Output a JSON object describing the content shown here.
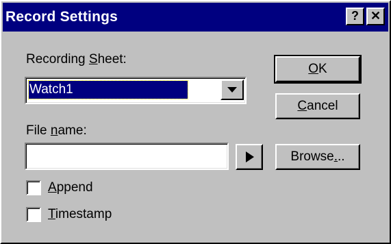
{
  "window": {
    "title": "Record Settings",
    "help_glyph": "?",
    "close_glyph": "✕"
  },
  "recording_sheet": {
    "label_pre": "Recording ",
    "label_mnemonic": "S",
    "label_post": "heet:",
    "selected": "Watch1"
  },
  "file_name": {
    "label_pre": "File ",
    "label_mnemonic": "n",
    "label_post": "ame:",
    "value": ""
  },
  "buttons": {
    "ok": {
      "mnemonic": "O",
      "rest": "K"
    },
    "cancel": {
      "mnemonic": "C",
      "rest": "ancel"
    },
    "browse": {
      "pre": "Browse",
      "mnemonic": ".",
      "post": ".."
    }
  },
  "checkboxes": {
    "append": {
      "mnemonic": "A",
      "rest": "ppend",
      "checked": false
    },
    "timestamp": {
      "mnemonic": "T",
      "rest": "imestamp",
      "checked": false
    }
  },
  "colors": {
    "title_bar": "#000080",
    "face": "#c0c0c0",
    "selection": "#000080"
  }
}
